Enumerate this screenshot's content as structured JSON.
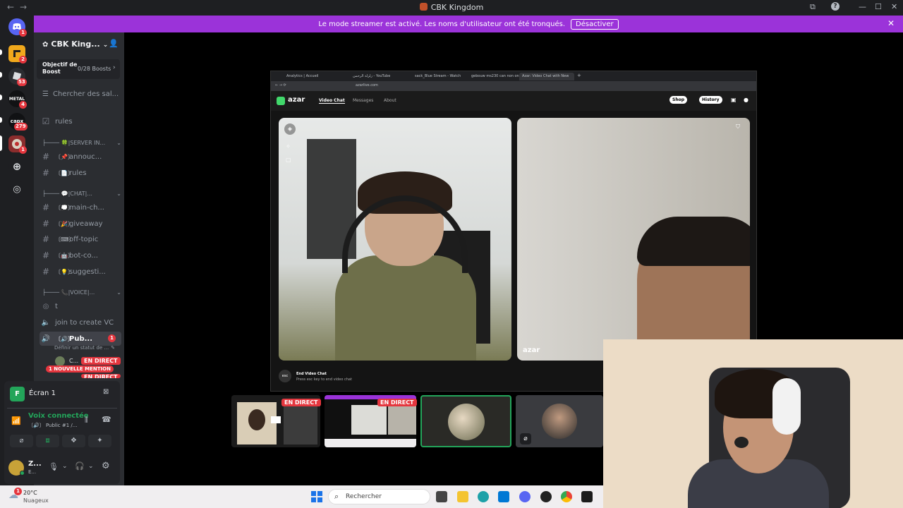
{
  "titlebar": {
    "title": "CBK Kingdom",
    "back": "←",
    "forward": "→",
    "controls": [
      "⧉",
      "?",
      "—",
      "☐",
      "✕"
    ]
  },
  "banner": {
    "text": "Le mode streamer est activé. Les noms d'utilisateur ont été tronqués.",
    "button": "Désactiver",
    "close": "✕"
  },
  "rail": {
    "servers": [
      {
        "label": "",
        "badge": "1",
        "color": "#5865f2"
      },
      {
        "label": "",
        "badge": "2",
        "color": "#f0a81c"
      },
      {
        "label": "",
        "badge": "53",
        "color": "#2b2d31"
      },
      {
        "label": "METAL",
        "badge": "4",
        "color": "#111214"
      },
      {
        "label": "capx",
        "badge": "279",
        "color": "#111214"
      },
      {
        "label": "",
        "badge": "1",
        "color": "#8b2d2d"
      }
    ]
  },
  "sidebar": {
    "server_name": "CBK King...",
    "boost_label": "Objectif de Boost",
    "boost_count": "0/28 Boosts",
    "browse": "Chercher des sal...",
    "channels": [
      {
        "type": "rules",
        "emoji": "",
        "name": "rules"
      },
      {
        "type": "category",
        "name": "├──── 🍀|SERVER IN..."
      },
      {
        "type": "text",
        "emoji": "〔📌〕",
        "name": "annouc..."
      },
      {
        "type": "text",
        "emoji": "〔📄〕",
        "name": "rules"
      },
      {
        "type": "category",
        "name": "├──── 💬|CHAT|..."
      },
      {
        "type": "text",
        "emoji": "〔💭〕",
        "name": "main-ch..."
      },
      {
        "type": "text",
        "emoji": "〔🎉〕",
        "name": "giveaway"
      },
      {
        "type": "text",
        "emoji": "〔⌨〕",
        "name": "off-topic"
      },
      {
        "type": "text",
        "emoji": "〔🤖〕",
        "name": "bot-co..."
      },
      {
        "type": "text",
        "emoji": "〔💡〕",
        "name": "suggesti..."
      },
      {
        "type": "category",
        "name": "├──── 📞|VOICE|..."
      },
      {
        "type": "stage",
        "emoji": "",
        "name": "t"
      },
      {
        "type": "voice",
        "emoji": "",
        "name": "join to create VC"
      },
      {
        "type": "voice-active",
        "emoji": "〔🔊〕",
        "name": "Pub...",
        "badge": "1"
      }
    ],
    "status_hint": "Définir un statut de ...",
    "member_initial": "C...",
    "live_label": "EN DIRECT",
    "mention_pill": "1 NOUVELLE MENTION"
  },
  "userpanel": {
    "screen_label": "Écran 1",
    "voice_status": "Voix connectée",
    "voice_channel": "〔🔊〕 Public #1 /...",
    "username": "Z...",
    "user_status": "E..."
  },
  "browser": {
    "tabs": [
      "Analytics | Accueil",
      "زلزلة الرحمن - YouTube",
      "sack_Blue Stream - Watch",
      "gebouw ms230 can non once h",
      "Azar: Video Chat with New"
    ],
    "url": "azarlive.com",
    "nav": [
      "Video Chat",
      "Messages",
      "About"
    ],
    "shop": "Shop",
    "history": "History",
    "end_title": "End Video Chat",
    "end_hint": "Press esc key to end video chat",
    "esc": "esc",
    "watermark": "azar"
  },
  "thumbs": {
    "live1": "EN DIRECT",
    "live2": "EN DIRECT"
  },
  "taskbar": {
    "temp": "20°C",
    "weather": "Nuageux",
    "weather_badge": "1",
    "search": "Rechercher"
  }
}
